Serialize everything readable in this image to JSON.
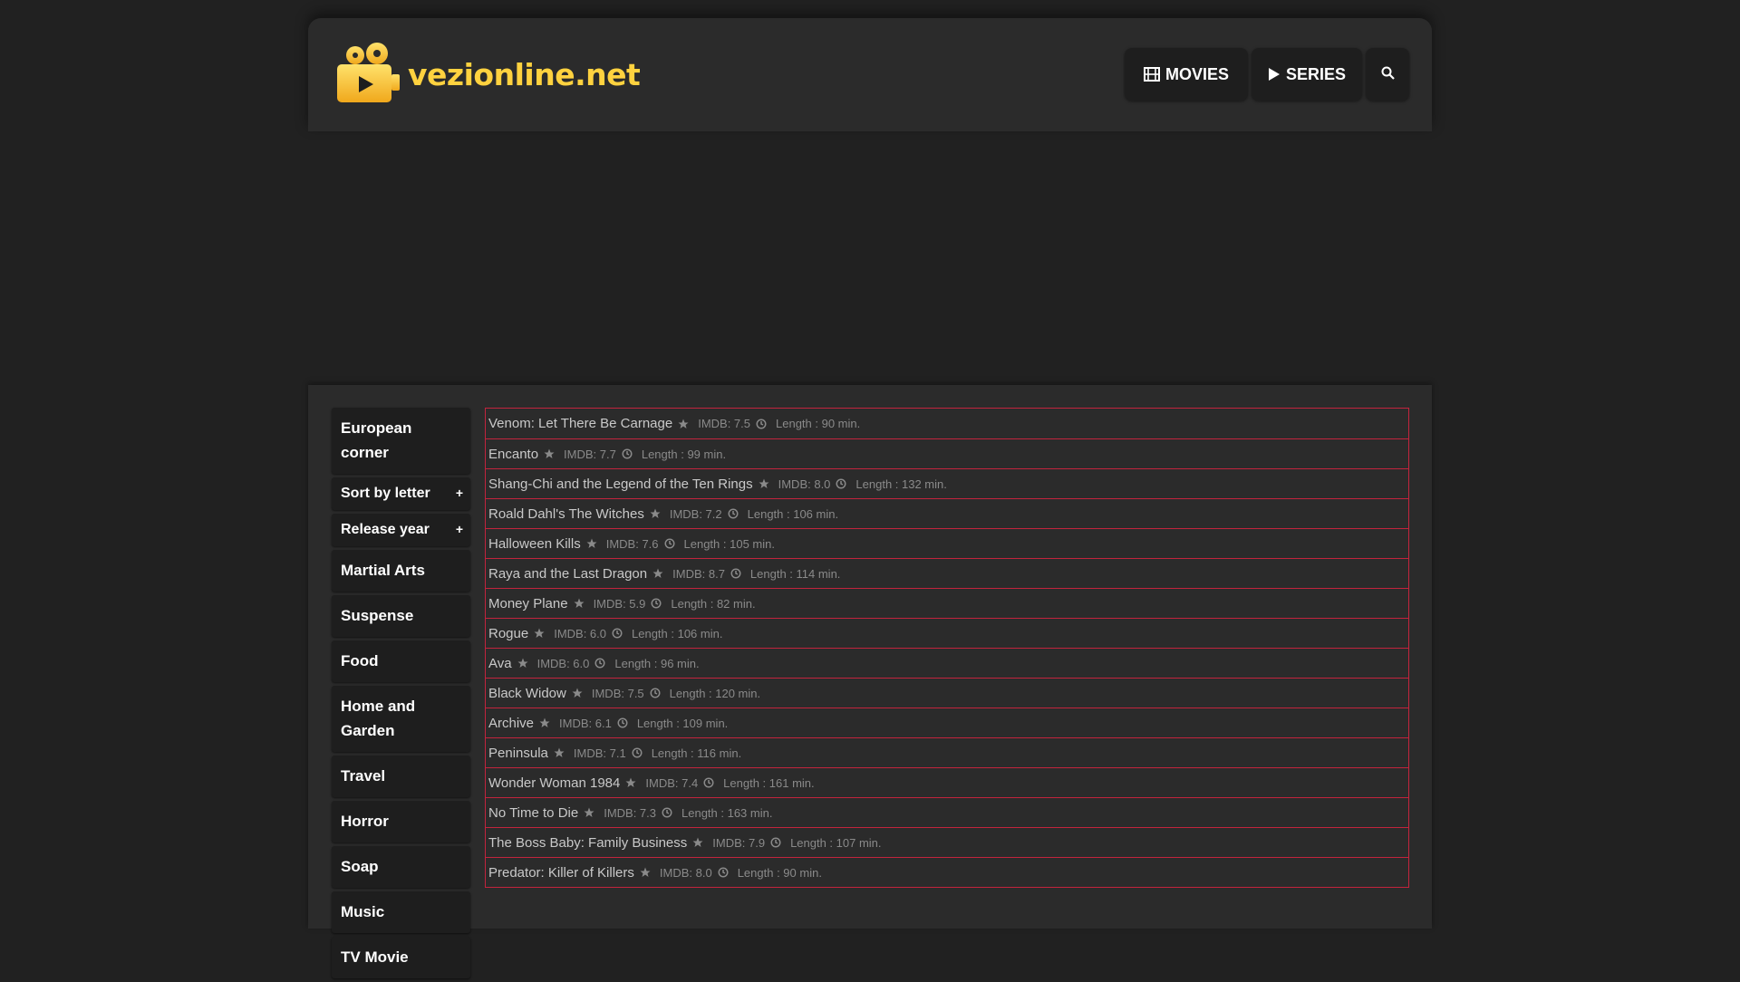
{
  "header": {
    "logo_text": "vezionline.net",
    "nav": {
      "movies_label": "MOVIES",
      "series_label": "SERIES"
    }
  },
  "sidebar": {
    "items": [
      {
        "label": "European corner",
        "expandable": false
      },
      {
        "label": "Sort by letter",
        "expandable": true,
        "toggle": "+"
      },
      {
        "label": "Release year",
        "expandable": true,
        "toggle": "+"
      },
      {
        "label": "Martial Arts"
      },
      {
        "label": "Suspense"
      },
      {
        "label": "Food"
      },
      {
        "label": "Home and Garden"
      },
      {
        "label": "Travel"
      },
      {
        "label": "Horror"
      },
      {
        "label": "Soap"
      },
      {
        "label": "Music"
      },
      {
        "label": "TV Movie"
      }
    ]
  },
  "movies": [
    {
      "title": "Venom: Let There Be Carnage",
      "imdb": "IMDB: 7.5",
      "length": "Length : 90 min."
    },
    {
      "title": "Encanto",
      "imdb": "IMDB: 7.7",
      "length": "Length : 99 min."
    },
    {
      "title": "Shang-Chi and the Legend of the Ten Rings",
      "imdb": "IMDB: 8.0",
      "length": "Length : 132 min."
    },
    {
      "title": "Roald Dahl's The Witches",
      "imdb": "IMDB: 7.2",
      "length": "Length : 106 min."
    },
    {
      "title": "Halloween Kills",
      "imdb": "IMDB: 7.6",
      "length": "Length : 105 min."
    },
    {
      "title": "Raya and the Last Dragon",
      "imdb": "IMDB: 8.7",
      "length": "Length : 114 min."
    },
    {
      "title": "Money Plane",
      "imdb": "IMDB: 5.9",
      "length": "Length : 82 min."
    },
    {
      "title": "Rogue",
      "imdb": "IMDB: 6.0",
      "length": "Length : 106 min."
    },
    {
      "title": "Ava",
      "imdb": "IMDB: 6.0",
      "length": "Length : 96 min."
    },
    {
      "title": "Black Widow",
      "imdb": "IMDB: 7.5",
      "length": "Length : 120 min."
    },
    {
      "title": "Archive",
      "imdb": "IMDB: 6.1",
      "length": "Length : 109 min."
    },
    {
      "title": "Peninsula",
      "imdb": "IMDB: 7.1",
      "length": "Length : 116 min."
    },
    {
      "title": "Wonder Woman 1984",
      "imdb": "IMDB: 7.4",
      "length": "Length : 161 min."
    },
    {
      "title": "No Time to Die",
      "imdb": "IMDB: 7.3",
      "length": "Length : 163 min."
    },
    {
      "title": "The Boss Baby: Family Business",
      "imdb": "IMDB: 7.9",
      "length": "Length : 107 min."
    },
    {
      "title": "Predator: Killer of Killers",
      "imdb": "IMDB: 8.0",
      "length": "Length : 90 min."
    }
  ],
  "colors": {
    "accent": "#ffd23f",
    "row_border": "#c2243d",
    "background": "#212121",
    "panel": "#2b2b2b"
  },
  "icons": {
    "movies": "film-icon",
    "series": "play-icon",
    "search": "search-icon",
    "rating": "star-icon",
    "length": "clock-icon"
  }
}
